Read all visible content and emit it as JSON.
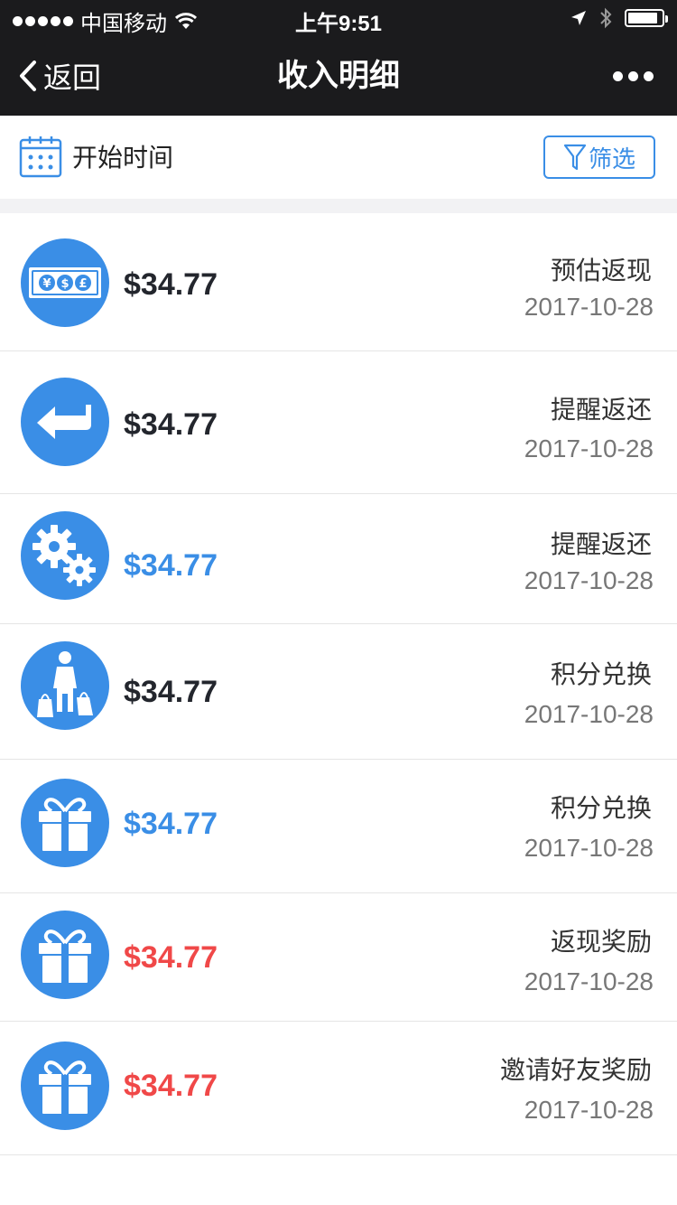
{
  "status_bar": {
    "carrier": "中国移动",
    "time": "上午9:51",
    "battery_level": 0.9
  },
  "nav": {
    "back_label": "返回",
    "title": "收入明细"
  },
  "filter_bar": {
    "start_time_label": "开始时间",
    "filter_label": "筛选"
  },
  "colors": {
    "accent": "#3a8ee6",
    "amount_dark": "#23262d",
    "amount_blue": "#3a8ee6",
    "amount_red": "#f04848"
  },
  "records": [
    {
      "icon": "money-bill-icon",
      "amount": "$34.77",
      "amount_color": "dark",
      "type": "预估返现",
      "date": "2017-10-28"
    },
    {
      "icon": "return-arrow-icon",
      "amount": "$34.77",
      "amount_color": "dark",
      "type": "提醒返还",
      "date": "2017-10-28"
    },
    {
      "icon": "gears-icon",
      "amount": "$34.77",
      "amount_color": "blue",
      "type": "提醒返还",
      "date": "2017-10-28"
    },
    {
      "icon": "shopper-icon",
      "amount": "$34.77",
      "amount_color": "dark",
      "type": "积分兑换",
      "date": "2017-10-28"
    },
    {
      "icon": "gift-icon",
      "amount": "$34.77",
      "amount_color": "blue",
      "type": "积分兑换",
      "date": "2017-10-28"
    },
    {
      "icon": "gift-icon",
      "amount": "$34.77",
      "amount_color": "red",
      "type": "返现奖励",
      "date": "2017-10-28"
    },
    {
      "icon": "gift-icon",
      "amount": "$34.77",
      "amount_color": "red",
      "type": "邀请好友奖励",
      "date": "2017-10-28"
    }
  ]
}
